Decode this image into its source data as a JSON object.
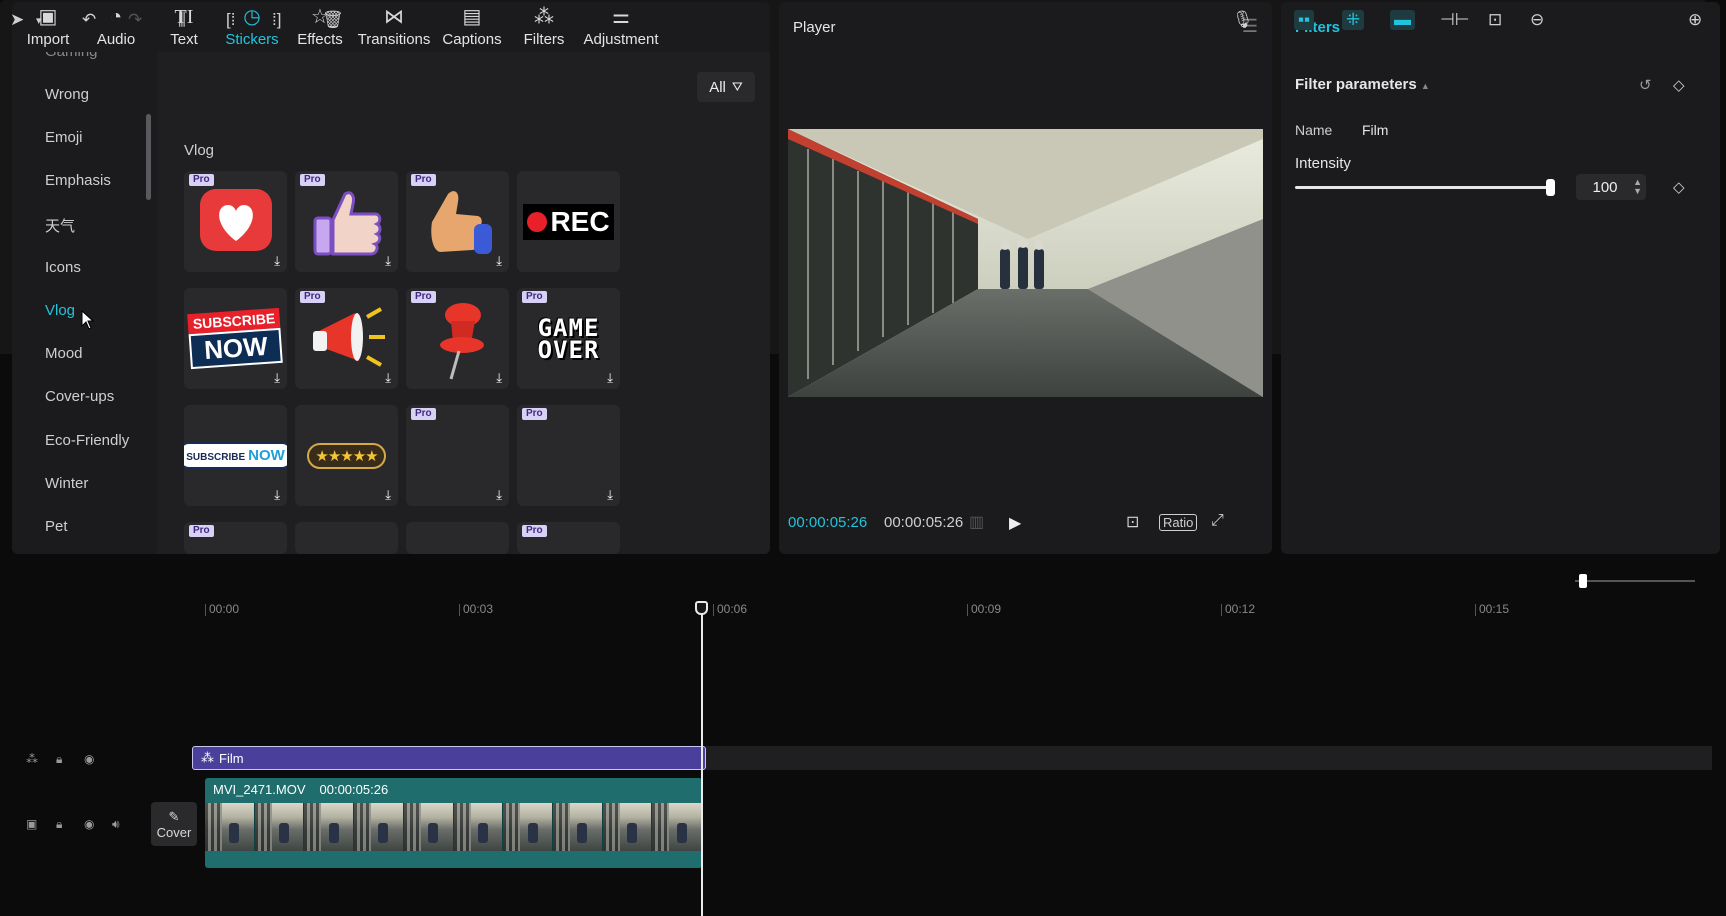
{
  "toolbar": {
    "items": [
      {
        "label": "Import",
        "icon": "import-icon"
      },
      {
        "label": "Audio",
        "icon": "audio-icon"
      },
      {
        "label": "Text",
        "icon": "text-icon"
      },
      {
        "label": "Stickers",
        "icon": "stickers-icon",
        "active": true
      },
      {
        "label": "Effects",
        "icon": "effects-icon"
      },
      {
        "label": "Transitions",
        "icon": "transitions-icon"
      },
      {
        "label": "Captions",
        "icon": "captions-icon"
      },
      {
        "label": "Filters",
        "icon": "filters-icon"
      },
      {
        "label": "Adjustment",
        "icon": "adjustment-icon"
      }
    ]
  },
  "categories": [
    "Gaming",
    "Wrong",
    "Emoji",
    "Emphasis",
    "天气",
    "Icons",
    "Vlog",
    "Mood",
    "Cover-ups",
    "Eco-Friendly",
    "Winter",
    "Pet"
  ],
  "active_category": "Vlog",
  "stickers": {
    "filter_label": "All",
    "section_title": "Vlog",
    "tiles": [
      {
        "name": "heart-sticker",
        "pro": true
      },
      {
        "name": "thumbs-up-sticker",
        "pro": true
      },
      {
        "name": "hand-thumbs-up-sticker",
        "pro": true
      },
      {
        "name": "rec-sticker",
        "pro": false,
        "text": "REC"
      },
      {
        "name": "subscribe-now-sticker",
        "pro": false,
        "text1": "SUBSCRIBE",
        "text2": "NOW"
      },
      {
        "name": "megaphone-sticker",
        "pro": true
      },
      {
        "name": "pushpin-sticker",
        "pro": true
      },
      {
        "name": "game-over-sticker",
        "pro": true,
        "text1": "GAME",
        "text2": "OVER"
      },
      {
        "name": "subscribe-now-bubble-sticker",
        "pro": false,
        "text1": "SUBSCRIBE",
        "text2": "NOW"
      },
      {
        "name": "five-stars-sticker",
        "pro": false,
        "text": "★★★★★"
      },
      {
        "name": "empty-sticker-1",
        "pro": true
      },
      {
        "name": "empty-sticker-2",
        "pro": true
      }
    ],
    "pro_label": "Pro"
  },
  "player": {
    "title": "Player",
    "current_time": "00:00:05:26",
    "total_time": "00:00:05:26",
    "ratio_label": "Ratio"
  },
  "filters_panel": {
    "title": "Filters",
    "section": "Filter parameters",
    "name_label": "Name",
    "name_value": "Film",
    "intensity_label": "Intensity",
    "intensity_value": "100",
    "intensity_fraction": 1.0
  },
  "timeline": {
    "ticks": [
      "00:00",
      "00:03",
      "00:06",
      "00:09",
      "00:12",
      "00:15"
    ],
    "filter_clip_label": "Film",
    "video_clip_name": "MVI_2471.MOV",
    "video_clip_duration": "00:00:05:26",
    "cover_label": "Cover"
  },
  "colors": {
    "accent": "#22c3dc",
    "filter_clip": "#4a3f9a",
    "video_clip": "#1f6d6d"
  }
}
